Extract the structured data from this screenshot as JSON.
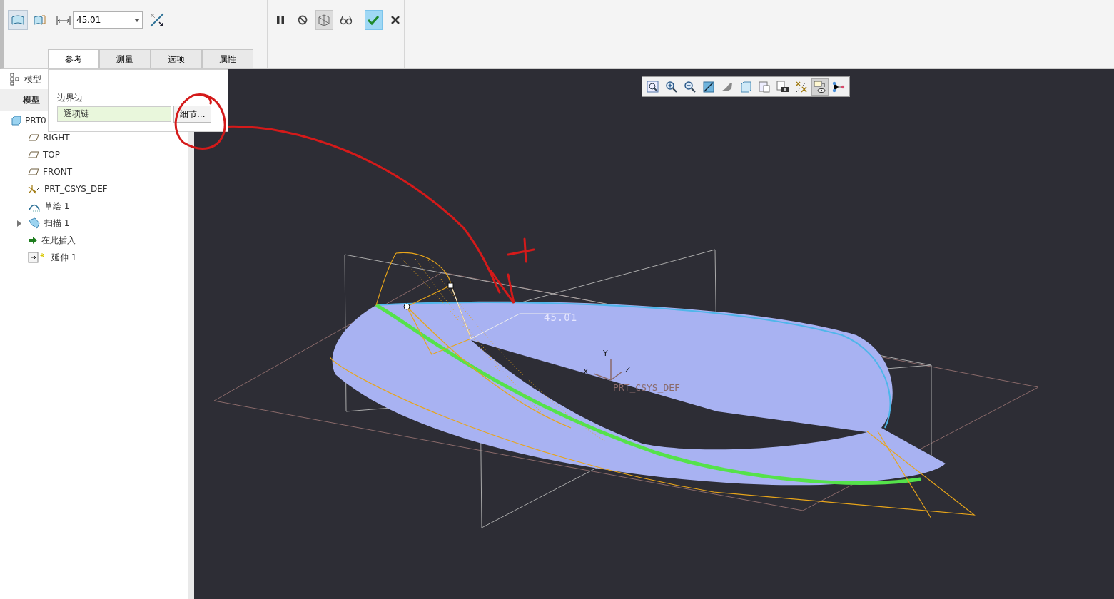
{
  "ribbon": {
    "type_buttons": [
      {
        "kind": "surface",
        "selected": true
      },
      {
        "kind": "surface-side",
        "selected": false
      }
    ],
    "distance": {
      "value": "45.01"
    },
    "tabs": [
      {
        "label": "参考",
        "selected": true
      },
      {
        "label": "测量",
        "selected": false
      },
      {
        "label": "选项",
        "selected": false
      },
      {
        "label": "属性",
        "selected": false
      }
    ],
    "controls": [
      {
        "kind": "pause",
        "selected": false
      },
      {
        "kind": "no",
        "selected": false
      },
      {
        "kind": "preview",
        "selected": true
      },
      {
        "kind": "glasses",
        "selected": false
      },
      {
        "kind": "ok",
        "selected": true
      },
      {
        "kind": "cancel",
        "selected": false
      }
    ]
  },
  "references_panel": {
    "label": "边界边",
    "field_value": "逐项链",
    "button": "细节..."
  },
  "model_tree": {
    "header": "模型",
    "subheader": "模型",
    "items": [
      {
        "label": "PRT0",
        "kind": "part",
        "children": [
          {
            "label": "RIGHT",
            "kind": "plane"
          },
          {
            "label": "TOP",
            "kind": "plane"
          },
          {
            "label": "FRONT",
            "kind": "plane"
          },
          {
            "label": "PRT_CSYS_DEF",
            "kind": "csys"
          },
          {
            "label": "草绘 1",
            "kind": "sketch"
          },
          {
            "label": "扫描 1",
            "kind": "sweep",
            "expanded": false
          },
          {
            "label": "在此插入",
            "kind": "insert"
          },
          {
            "label": "延伸 1",
            "kind": "extend"
          }
        ]
      }
    ]
  },
  "view_toolbar": [
    {
      "kind": "zoom-fit",
      "selected": false
    },
    {
      "kind": "zoom-in",
      "selected": false
    },
    {
      "kind": "zoom-out",
      "selected": false
    },
    {
      "kind": "repaint",
      "selected": false
    },
    {
      "kind": "shade",
      "selected": false
    },
    {
      "kind": "cube",
      "selected": false
    },
    {
      "kind": "views",
      "selected": false
    },
    {
      "kind": "camera",
      "selected": false
    },
    {
      "kind": "datum",
      "selected": false
    },
    {
      "kind": "manager",
      "selected": true
    },
    {
      "kind": "nodes",
      "selected": false
    }
  ],
  "viewport": {
    "dimension": "45.01",
    "axes": [
      "Y",
      "X",
      "Z"
    ],
    "csys_label": "PRT_CSYS_DEF"
  }
}
